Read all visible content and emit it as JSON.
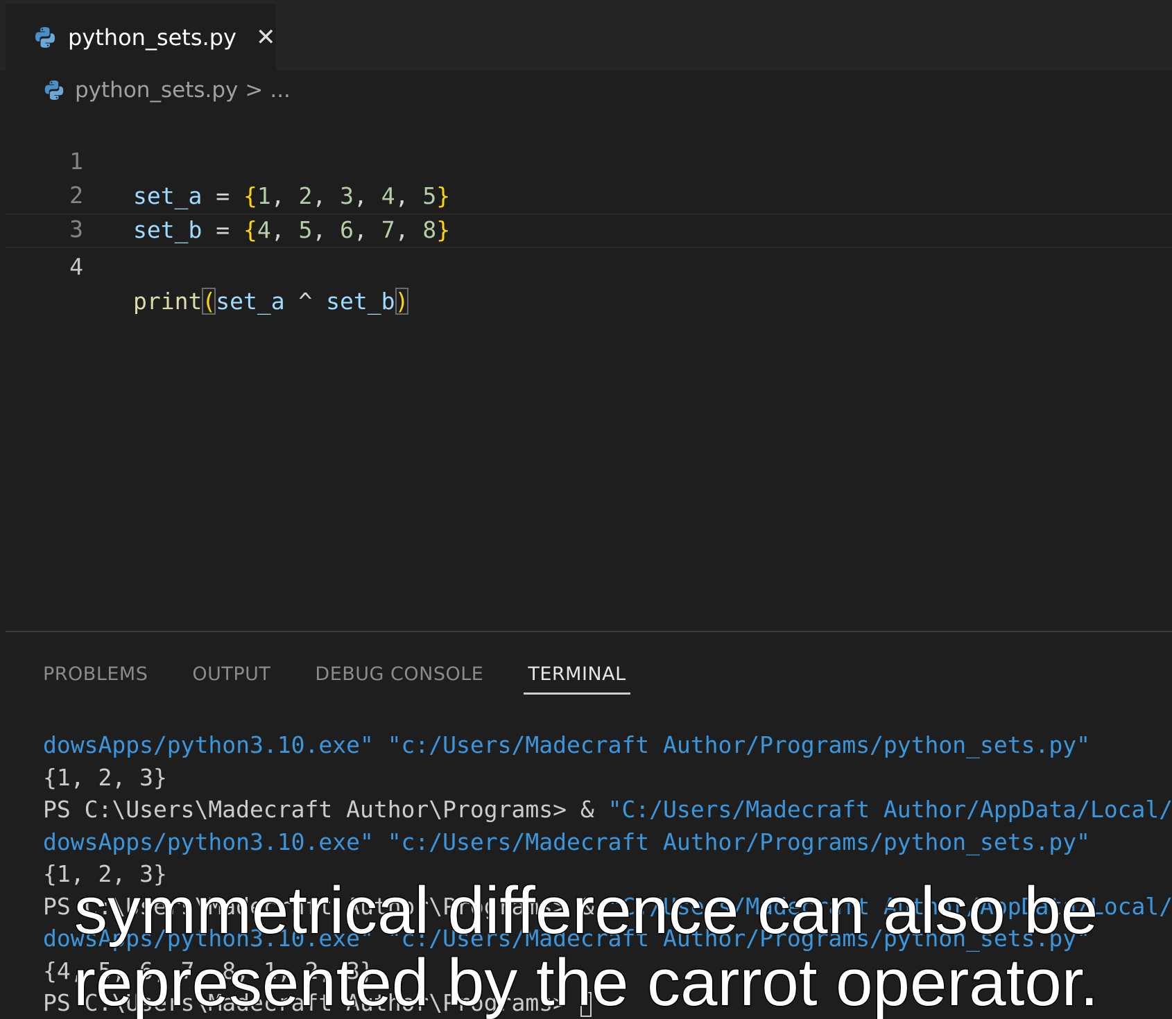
{
  "tab": {
    "label": "python_sets.py",
    "close": "✕",
    "icon": "python-icon"
  },
  "breadcrumb": {
    "file": "python_sets.py",
    "separator": ">",
    "more": "..."
  },
  "editor": {
    "line_numbers": [
      "1",
      "2",
      "3",
      "4"
    ],
    "lines": [
      [
        "set_a",
        " = ",
        "{",
        "1",
        ", ",
        "2",
        ", ",
        "3",
        ", ",
        "4",
        ", ",
        "5",
        "}"
      ],
      [
        "set_b",
        " = ",
        "{",
        "4",
        ", ",
        "5",
        ", ",
        "6",
        ", ",
        "7",
        ", ",
        "8",
        "}"
      ],
      [],
      [
        "print",
        "(",
        "set_a",
        " ^ ",
        "set_b",
        ")"
      ]
    ]
  },
  "panel": {
    "tabs": [
      "PROBLEMS",
      "OUTPUT",
      "DEBUG CONSOLE",
      "TERMINAL"
    ],
    "active": "TERMINAL"
  },
  "terminal": {
    "lines": [
      "dowsApps/python3.10.exe\" \"c:/Users/Madecraft Author/Programs/python_sets.py\"",
      "{1, 2, 3}",
      "PS C:\\Users\\Madecraft Author\\Programs> & ",
      "\"C:/Users/Madecraft Author/AppData/Local/Mi",
      "dowsApps/python3.10.exe\" \"c:/Users/Madecraft Author/Programs/python_sets.py\"",
      "{1, 2, 3}",
      "PS C:\\Users\\Madecraft Author\\Programs> & ",
      "\"C:/Users/Madecraft Author/AppData/Local/Mi",
      "dowsApps/python3.10.exe\" \"c:/Users/Madecraft Author/Programs/python_sets.py\"",
      "{4, 5, 6, 7, 8, 1, 2, 3}",
      "PS C:\\Users\\Madecraft Author\\Programs> "
    ]
  },
  "caption": {
    "line1": "symmetrical difference can also be",
    "line2": "represented by the carrot operator."
  },
  "colors": {
    "keyword_var": "#9cdcfe",
    "number": "#b5cea8",
    "brace": "#ffd700",
    "function": "#dcdcaa",
    "terminal_path": "#3a96dd"
  }
}
